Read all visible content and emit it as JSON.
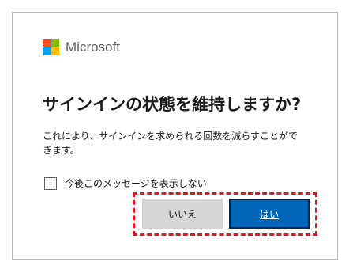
{
  "brand": {
    "name": "Microsoft",
    "logo_colors": [
      "#f25022",
      "#7fba00",
      "#00a4ef",
      "#ffb900"
    ]
  },
  "dialog": {
    "title": "サインインの状態を維持しますか?",
    "description": "これにより、サインインを求められる回数を減らすことができます。",
    "checkbox_label": "今後このメッセージを表示しない",
    "checkbox_checked": false
  },
  "buttons": {
    "no_label": "いいえ",
    "yes_label": "はい"
  },
  "colors": {
    "primary": "#0067b8",
    "secondary": "#d6d6d6",
    "highlight": "#e5132b"
  }
}
